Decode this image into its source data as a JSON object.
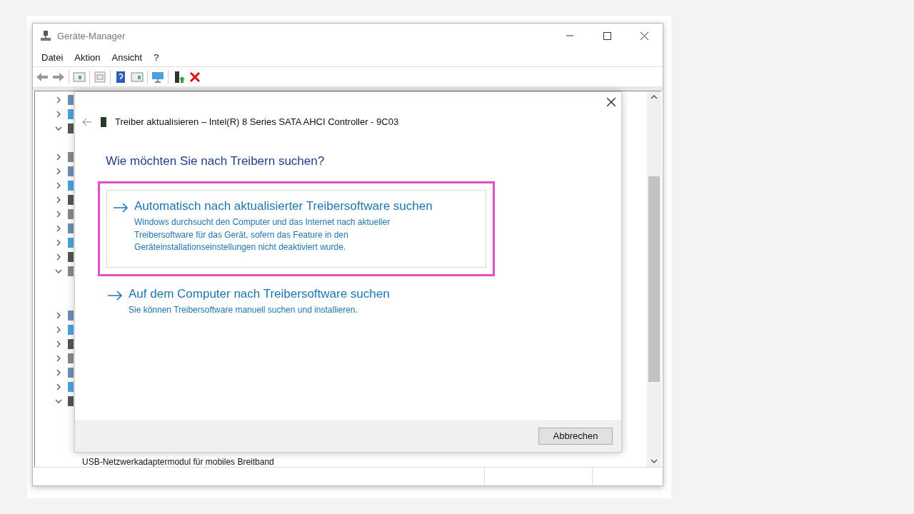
{
  "window": {
    "title": "Geräte-Manager"
  },
  "menu": [
    "Datei",
    "Aktion",
    "Ansicht",
    "?"
  ],
  "tree": [
    {
      "expanded": false
    },
    {
      "expanded": false
    },
    {
      "expanded": true
    },
    {
      "expanded": false
    },
    {
      "expanded": false
    },
    {
      "expanded": false
    },
    {
      "expanded": false
    },
    {
      "expanded": false
    },
    {
      "expanded": false
    },
    {
      "expanded": false
    },
    {
      "expanded": false
    },
    {
      "expanded": true
    },
    {
      "expanded": false
    },
    {
      "expanded": false
    },
    {
      "expanded": false
    },
    {
      "expanded": false
    },
    {
      "expanded": false
    },
    {
      "expanded": false
    },
    {
      "expanded": true,
      "children": [
        {
          "label": "USB-Netzwerkadaptermodul für mobiles Breitband"
        }
      ]
    }
  ],
  "dialog": {
    "title": "Treiber aktualisieren – Intel(R) 8 Series SATA AHCI Controller - 9C03",
    "heading": "Wie möchten Sie nach Treibern suchen?",
    "options": [
      {
        "title": "Automatisch nach aktualisierter Treibersoftware suchen",
        "description": "Windows durchsucht den Computer und das Internet nach aktueller Treibersoftware für das Gerät, sofern das Feature in den Geräteinstallationseinstellungen nicht deaktiviert wurde.",
        "selected": true
      },
      {
        "title": "Auf dem Computer nach Treibersoftware suchen",
        "description": "Sie können Treibersoftware manuell suchen und installieren.",
        "selected": false
      }
    ],
    "buttons": [
      "Abbrechen"
    ]
  }
}
